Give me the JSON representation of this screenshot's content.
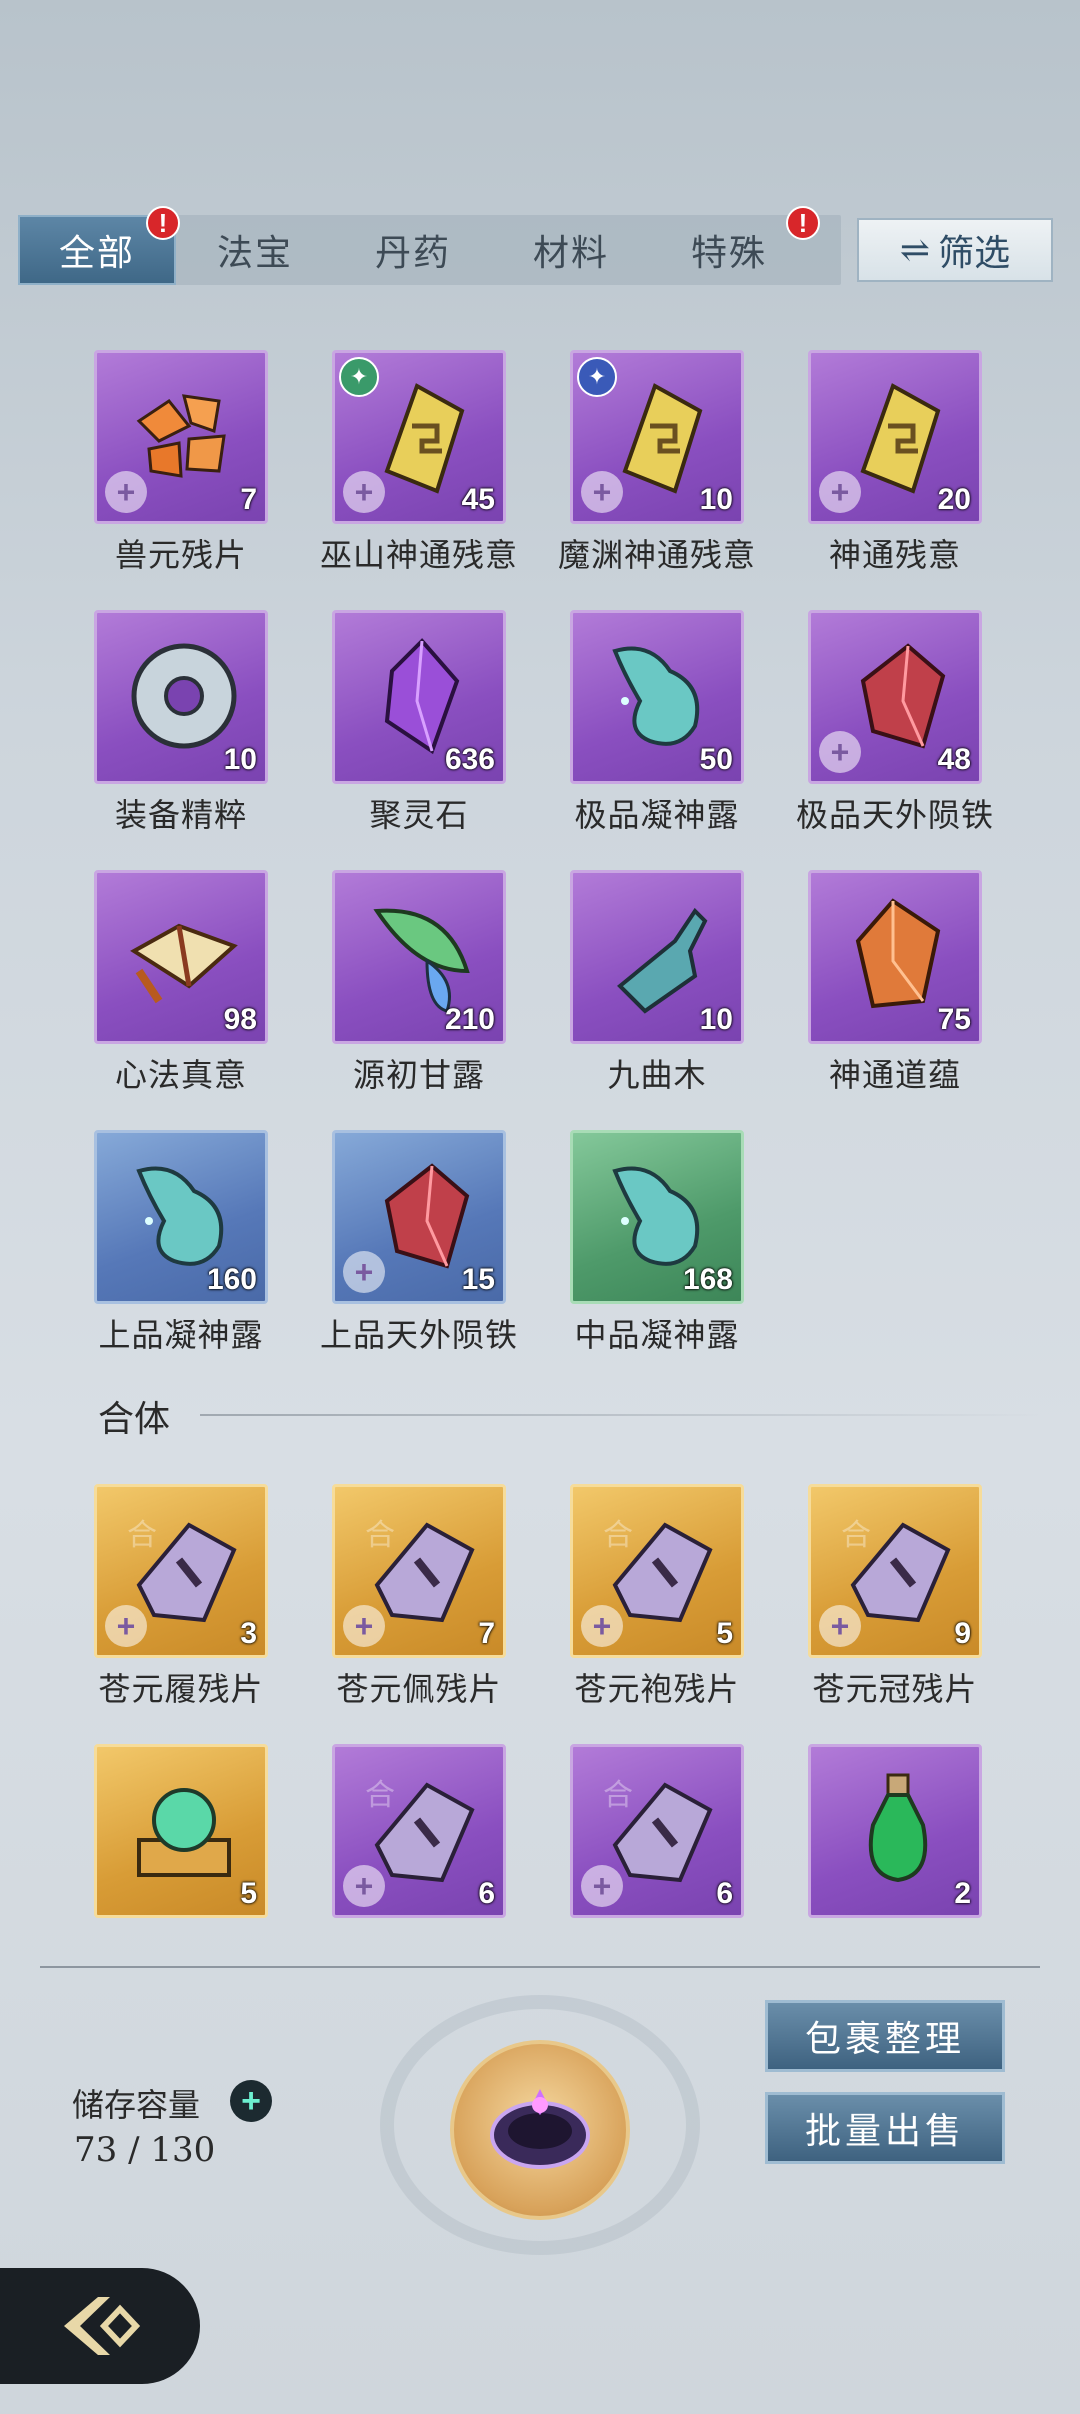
{
  "tabs": [
    {
      "label": "全部",
      "active": true,
      "badge": "!"
    },
    {
      "label": "法宝",
      "active": false
    },
    {
      "label": "丹药",
      "active": false
    },
    {
      "label": "材料",
      "active": false
    },
    {
      "label": "特殊",
      "active": false,
      "badge": "!"
    }
  ],
  "filter": {
    "label": "筛选",
    "icon": "swap-arrows-icon"
  },
  "items": [
    {
      "name": "兽元残片",
      "count": "7",
      "rarity": "purple",
      "art": "shards-orange"
    },
    {
      "name": "巫山神通残意",
      "count": "45",
      "rarity": "purple",
      "art": "gold-scroll",
      "corner": "green"
    },
    {
      "name": "魔渊神通残意",
      "count": "10",
      "rarity": "purple",
      "art": "gold-scroll",
      "corner": "blue"
    },
    {
      "name": "神通残意",
      "count": "20",
      "rarity": "purple",
      "art": "gold-scroll"
    },
    {
      "name": "装备精粹",
      "count": "10",
      "rarity": "purple",
      "art": "ring-disc"
    },
    {
      "name": "聚灵石",
      "count": "636",
      "rarity": "purple",
      "art": "purple-crystal"
    },
    {
      "name": "极品凝神露",
      "count": "50",
      "rarity": "purple",
      "art": "teal-flask"
    },
    {
      "name": "极品天外陨铁",
      "count": "48",
      "rarity": "purple",
      "art": "red-ore"
    },
    {
      "name": "心法真意",
      "count": "98",
      "rarity": "purple",
      "art": "golden-book"
    },
    {
      "name": "源初甘露",
      "count": "210",
      "rarity": "purple",
      "art": "leaf-dew"
    },
    {
      "name": "九曲木",
      "count": "10",
      "rarity": "purple",
      "art": "twisted-wood"
    },
    {
      "name": "神通道蕴",
      "count": "75",
      "rarity": "purple",
      "art": "amber-crystal"
    },
    {
      "name": "上品凝神露",
      "count": "160",
      "rarity": "blue",
      "art": "teal-flask"
    },
    {
      "name": "上品天外陨铁",
      "count": "15",
      "rarity": "blue",
      "art": "red-ore"
    },
    {
      "name": "中品凝神露",
      "count": "168",
      "rarity": "green",
      "art": "teal-flask"
    }
  ],
  "section": {
    "title": "合体"
  },
  "heti_items": [
    {
      "name": "苍元履残片",
      "count": "3",
      "rarity": "gold"
    },
    {
      "name": "苍元佩残片",
      "count": "7",
      "rarity": "gold"
    },
    {
      "name": "苍元袍残片",
      "count": "5",
      "rarity": "gold"
    },
    {
      "name": "苍元冠残片",
      "count": "9",
      "rarity": "gold"
    },
    {
      "name": "",
      "count": "5",
      "rarity": "gold",
      "art": "jade-orb"
    },
    {
      "name": "",
      "count": "6",
      "rarity": "purple"
    },
    {
      "name": "",
      "count": "6",
      "rarity": "purple"
    },
    {
      "name": "",
      "count": "2",
      "rarity": "purple",
      "art": "green-bottle"
    }
  ],
  "storage": {
    "label": "储存容量",
    "value": "73 / 130"
  },
  "buttons": {
    "organize": "包裹整理",
    "bulk_sell": "批量出售"
  },
  "colors": {
    "tab_active": "#4a7494",
    "badge": "#d8262a",
    "action": "#4e7290"
  }
}
